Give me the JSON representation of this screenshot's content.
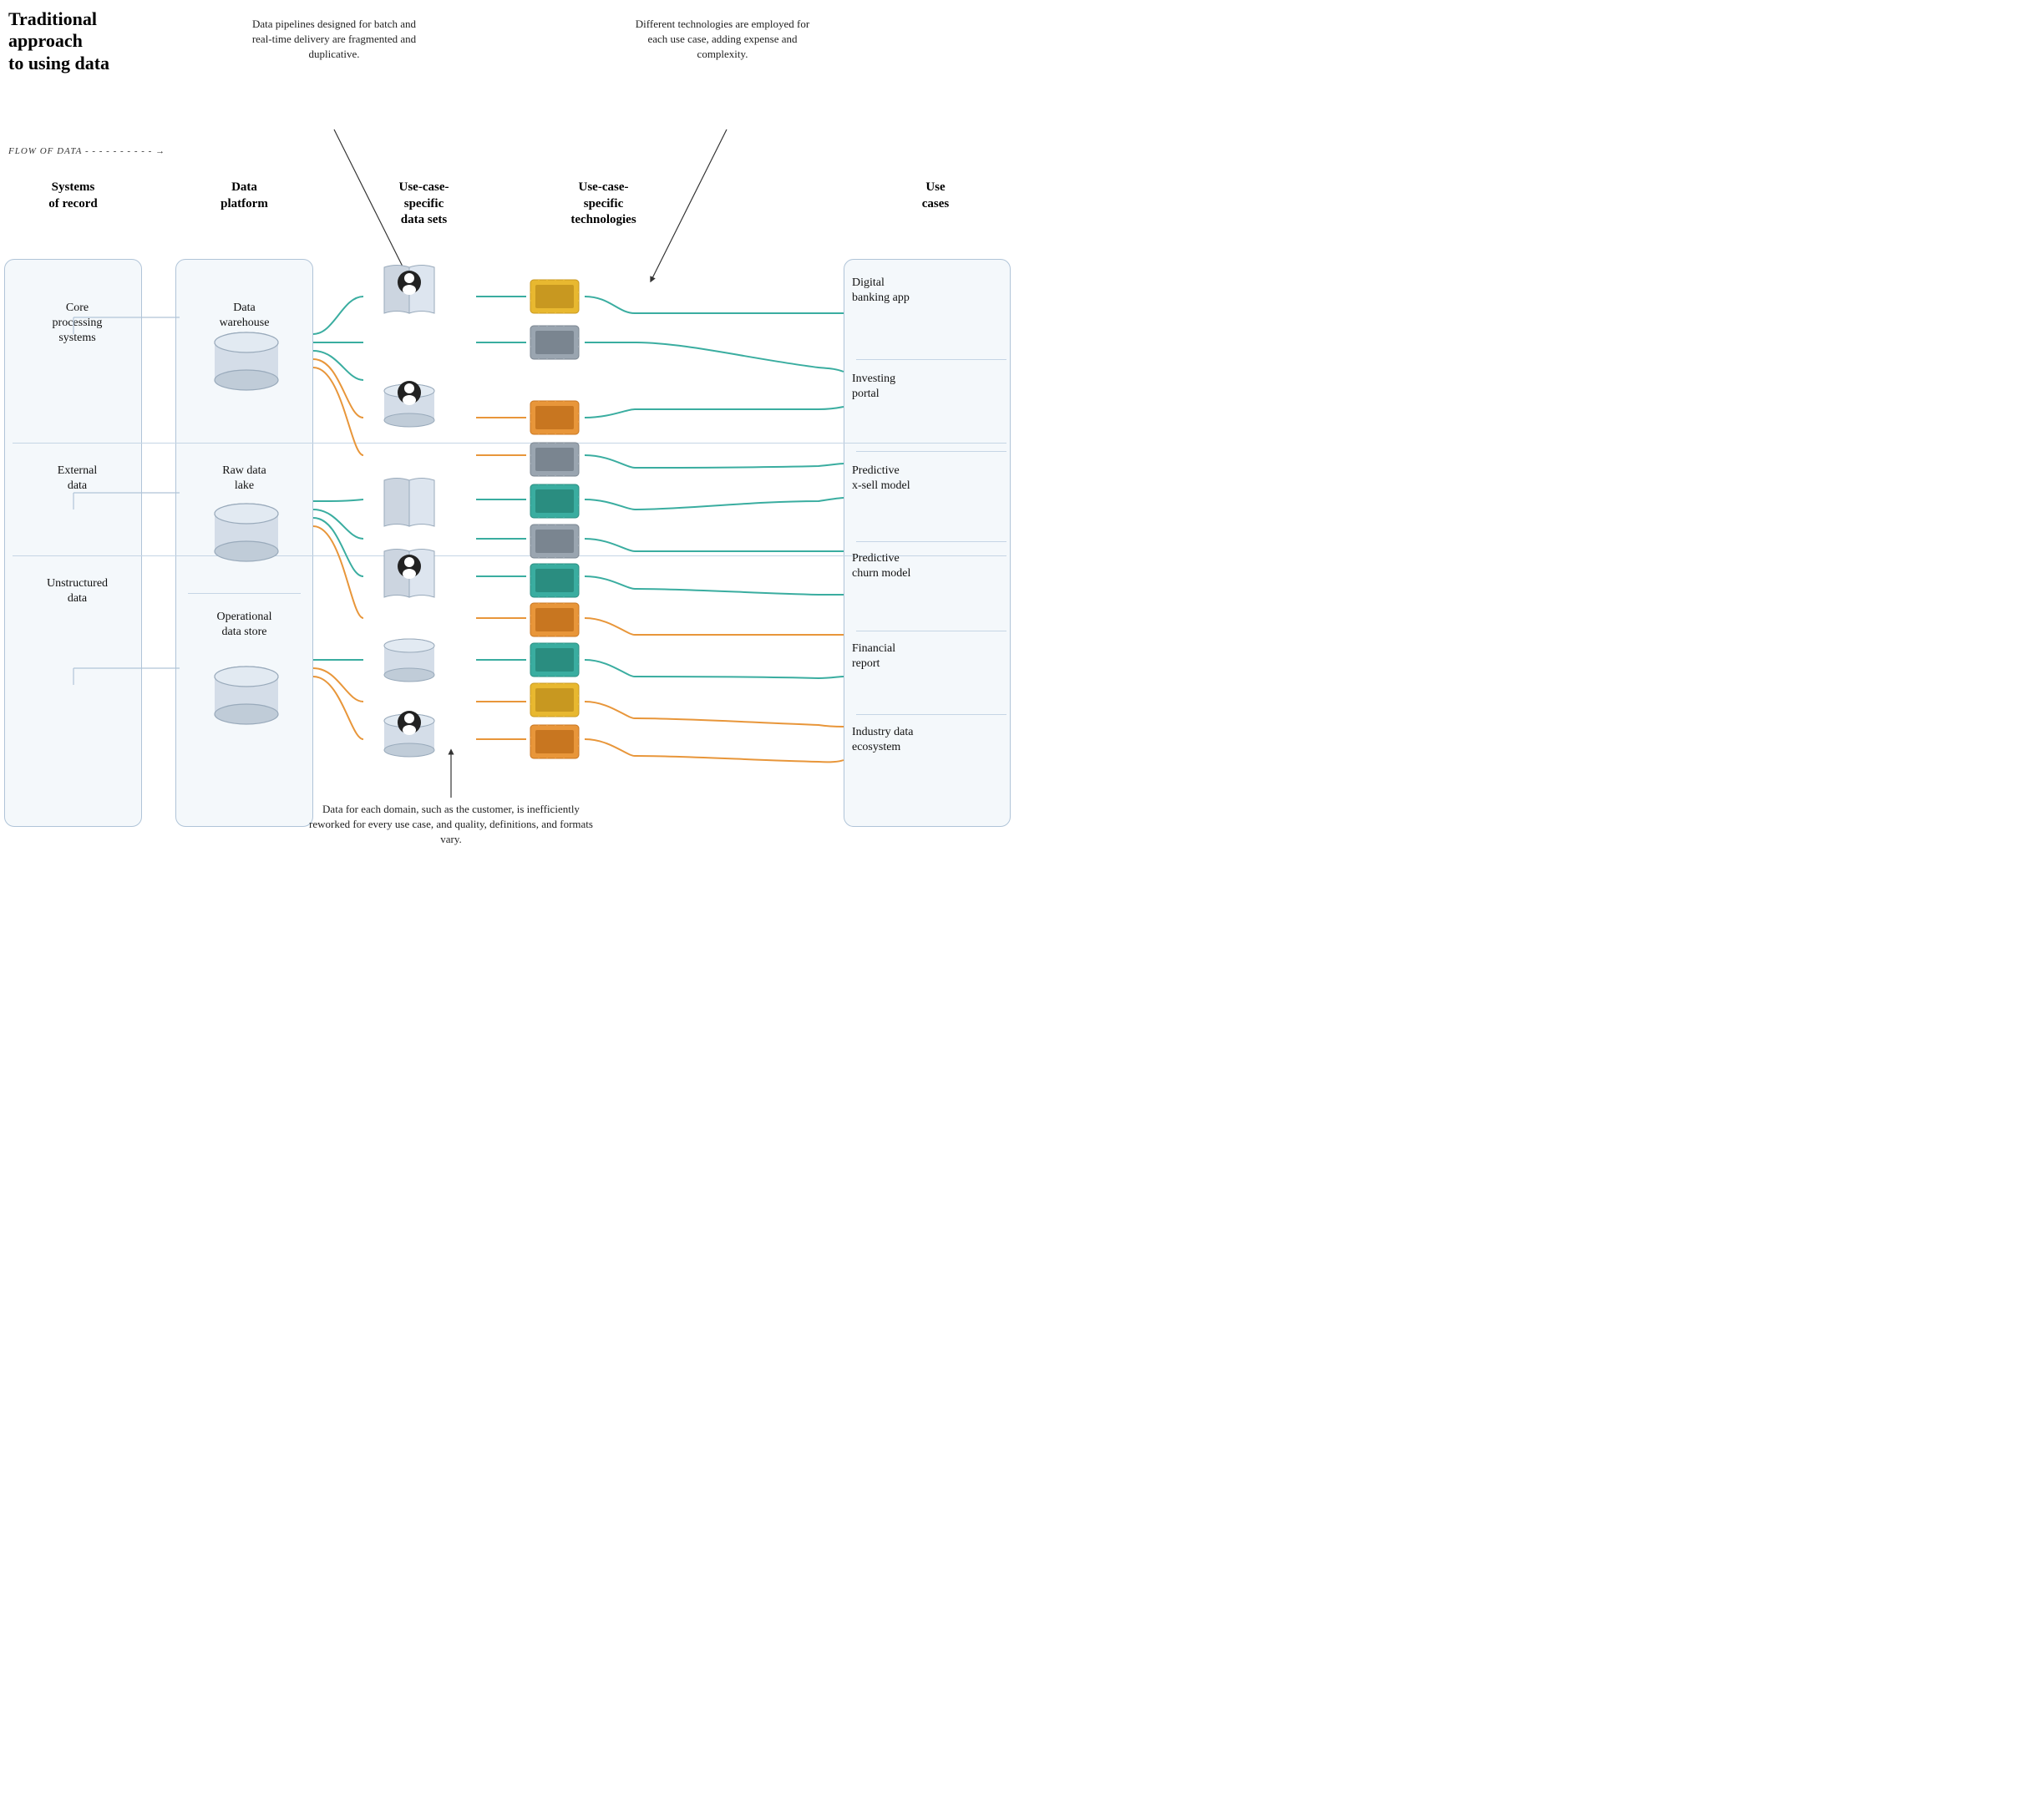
{
  "title": {
    "line1": "Traditional",
    "line2": "approach",
    "line3": "to using data"
  },
  "flow_label": "FLOW OF DATA",
  "columns": {
    "sor": "Systems\nof record",
    "dp": "Data\nplatform",
    "ds": "Use-case-\nspecific\ndata sets",
    "tech": "Use-case-\nspecific\ntechnologies",
    "uc": "Use\ncases"
  },
  "sor_items": [
    "Core\nprocessing\nsystems",
    "External\ndata",
    "Unstructured\ndata"
  ],
  "dp_items": [
    "Data\nwarehouse",
    "Raw data\nlake",
    "Operational\ndata store"
  ],
  "uc_items": [
    "Digital\nbanking app",
    "Investing\nportal",
    "Predictive\nx-sell model",
    "Predictive\nchurn model",
    "Financial\nreport",
    "Industry data\necosystem"
  ],
  "callout_top_left": "Data pipelines designed for batch and real-time delivery are fragmented and duplicative.",
  "callout_top_right": "Different technologies are employed for each use case, adding expense and complexity.",
  "callout_bottom": "Data for each domain, such as the customer, is inefficiently reworked for every use case, and quality, definitions, and formats vary.",
  "colors": {
    "teal": "#3aada0",
    "orange": "#e8963a",
    "gray_chip": "#9aa5b0",
    "connector_teal": "#3aada0",
    "connector_orange": "#e8963a",
    "box_border": "#b0c4d8",
    "box_bg": "#f4f8fb"
  }
}
